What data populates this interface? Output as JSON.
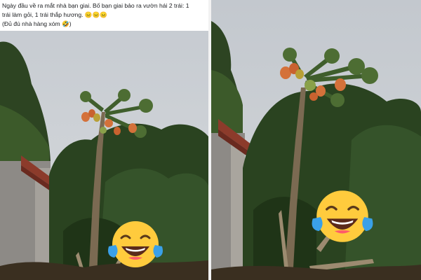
{
  "post": {
    "caption_line1": "Ngày đầu về ra mắt nhà bạn giai. Bố bạn giai bảo ra vườn hái 2 trái: 1",
    "caption_line2": "trái làm gỏi, 1 trái thắp hương. 😑😑😑",
    "caption_line3": "(Đủ đú nhà hàng xóm 🤣)"
  },
  "panels": [
    {
      "id": "left",
      "subject": "papaya tree with fruit, house roof and garden trees",
      "overlay": "laughing-crying-emoji"
    },
    {
      "id": "right",
      "subject": "papaya tree with fruit, close view",
      "overlay": "laughing-crying-emoji"
    }
  ],
  "colors": {
    "sky": "#c9ced3",
    "foliage_dark": "#243b1c",
    "foliage_mid": "#3f5e2c",
    "fruit": "#d4713a",
    "trunk": "#7b6a52",
    "emoji_face": "#ffcb3d",
    "emoji_tears": "#3aa0e8"
  }
}
